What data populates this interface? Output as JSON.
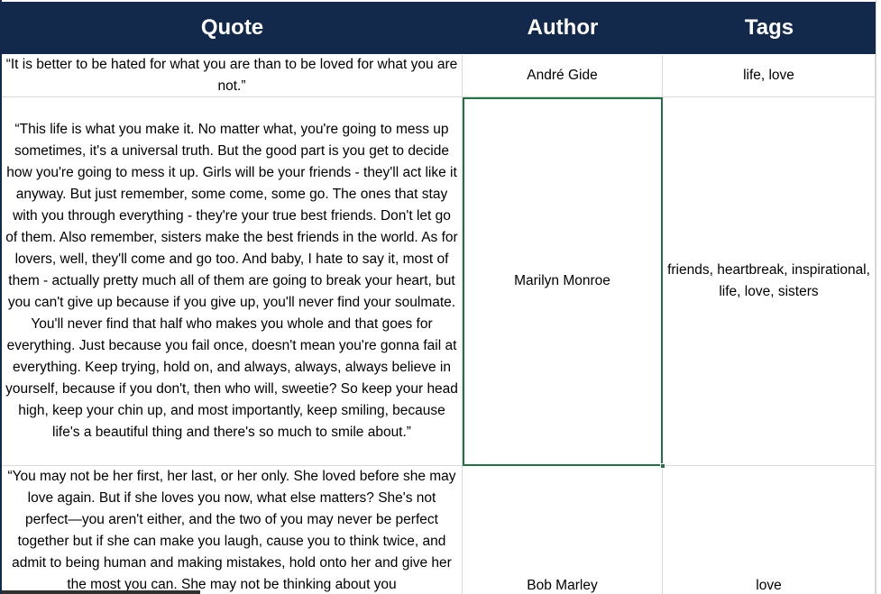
{
  "table": {
    "headers": {
      "quote": "Quote",
      "author": "Author",
      "tags": "Tags"
    },
    "rows": [
      {
        "quote": "“It is better to be hated for what you are than to be loved for what you are not.”",
        "author": "André Gide",
        "tags": "life, love"
      },
      {
        "quote": "“This life is what you make it. No matter what, you're going to mess up sometimes, it's a universal truth. But the good part is you get to decide how you're going to mess it up. Girls will be your friends - they'll act like it anyway. But just remember, some come, some go. The ones that stay with you through everything - they're your true best friends. Don't let go of them. Also remember, sisters make the best friends in the world. As for lovers, well, they'll come and go too. And baby, I hate to say it, most of them - actually pretty much all of them are going to break your heart, but you can't give up because if you give up, you'll never find your soulmate. You'll never find that half who makes you whole and that goes for everything. Just because you fail once, doesn't mean you're gonna fail at everything. Keep trying, hold on, and always, always, always believe in yourself, because if you don't, then who will, sweetie? So keep your head high, keep your chin up, and most importantly, keep smiling, because life's a beautiful thing and there's so much to smile about.”",
        "author": "Marilyn Monroe",
        "tags": "friends, heartbreak, inspirational, life, love, sisters"
      },
      {
        "quote": "“You may not be her first, her last, or her only. She loved before she may love again. But if she loves you now, what else matters? She's not perfect—you aren't either, and the two of you may never be perfect together but if she can make you laugh, cause you to think twice, and admit to being human and making mistakes, hold onto her and give her the most you can. She may not be thinking about you",
        "author": "Bob Marley",
        "tags": "love"
      }
    ]
  },
  "selection": {
    "cell": "Marilyn Monroe",
    "color": "#217346"
  },
  "colors": {
    "header_bg": "#13294b",
    "header_text": "#ffffff",
    "gridline": "#d9d9d9"
  }
}
